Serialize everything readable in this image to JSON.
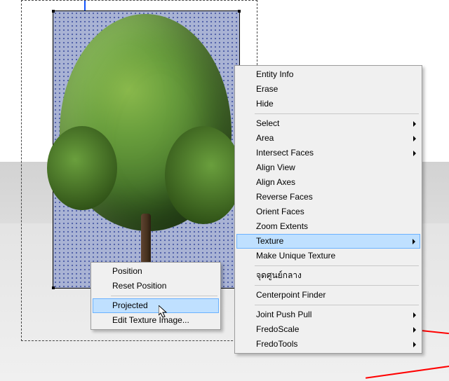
{
  "main_menu": {
    "entity_info": "Entity Info",
    "erase": "Erase",
    "hide": "Hide",
    "select": "Select",
    "area": "Area",
    "intersect": "Intersect Faces",
    "align_view": "Align View",
    "align_axes": "Align Axes",
    "reverse_faces": "Reverse Faces",
    "orient_faces": "Orient Faces",
    "zoom_extents": "Zoom Extents",
    "texture": "Texture",
    "make_unique": "Make Unique Texture",
    "thai_center": "จุดศูนย์กลาง",
    "centerpoint": "Centerpoint Finder",
    "joint_push_pull": "Joint Push Pull",
    "fredo_scale": "FredoScale",
    "fredo_tools": "FredoTools"
  },
  "sub_menu": {
    "position": "Position",
    "reset_position": "Reset Position",
    "projected": "Projected",
    "edit_image": "Edit Texture Image..."
  }
}
